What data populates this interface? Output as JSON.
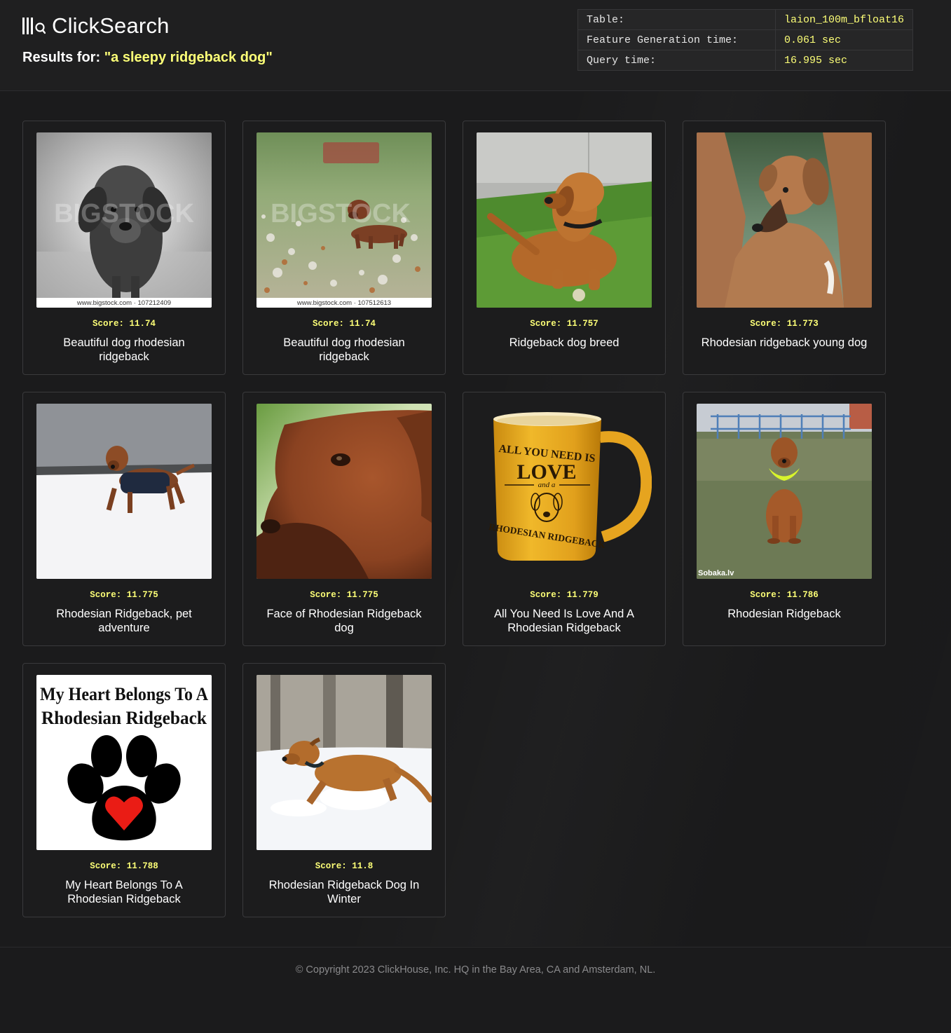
{
  "app": {
    "name": "ClickSearch",
    "logo_icon": "clickhouse-bars-search-icon"
  },
  "results": {
    "prefix": "Results for:",
    "query": "\"a sleepy ridgeback dog\""
  },
  "stats": {
    "rows": [
      {
        "label": "Table:",
        "value": "laion_100m_bfloat16"
      },
      {
        "label": "Feature Generation time:",
        "value": "0.061 sec"
      },
      {
        "label": "Query time:",
        "value": "16.995 sec"
      }
    ]
  },
  "items": [
    {
      "score_label": "Score: 11.74",
      "caption": "Beautiful dog rhodesian ridgeback",
      "image": "bw-puppy-photo",
      "watermark_text": "www.bigstock.com · 107212409",
      "watermark_logo": "BIGSTOCK"
    },
    {
      "score_label": "Score: 11.74",
      "caption": "Beautiful dog rhodesian ridgeback",
      "image": "puppy-in-field-photo",
      "watermark_text": "www.bigstock.com · 107512613",
      "watermark_logo": "BIGSTOCK"
    },
    {
      "score_label": "Score: 11.757",
      "caption": "Ridgeback dog breed",
      "image": "dog-lying-grass-photo"
    },
    {
      "score_label": "Score: 11.773",
      "caption": "Rhodesian ridgeback young dog",
      "image": "young-dog-closeup-photo"
    },
    {
      "score_label": "Score: 11.775",
      "caption": "Rhodesian Ridgeback, pet adventure",
      "image": "dog-in-snow-jacket-photo"
    },
    {
      "score_label": "Score: 11.775",
      "caption": "Face of Rhodesian Ridgeback dog",
      "image": "dog-face-profile-photo"
    },
    {
      "score_label": "Score: 11.779",
      "caption": "All You Need Is Love And A Rhodesian Ridgeback",
      "image": "yellow-mug-photo",
      "mug_text": {
        "line1": "ALL YOU NEED IS",
        "line2": "LOVE",
        "line3": "and a",
        "line4": "RHODESIAN RIDGEBACK"
      }
    },
    {
      "score_label": "Score: 11.786",
      "caption": "Rhodesian Ridgeback",
      "image": "dog-sitting-park-photo",
      "watermark_text": "Sobaka.lv"
    },
    {
      "score_label": "Score: 11.788",
      "caption": "My Heart Belongs To A Rhodesian Ridgeback",
      "image": "paw-heart-graphic",
      "graphic_text": {
        "line1": "My Heart Belongs To A",
        "line2": "Rhodesian Ridgeback"
      }
    },
    {
      "score_label": "Score: 11.8",
      "caption": "Rhodesian Ridgeback Dog In Winter",
      "image": "dog-running-snow-photo"
    }
  ],
  "footer": {
    "text": "© Copyright 2023 ClickHouse, Inc. HQ in the Bay Area, CA and Amsterdam, NL."
  },
  "colors": {
    "background": "#1b1b1c",
    "accent_yellow": "#fdff77",
    "card_border": "#3a3a3c",
    "footer_text": "#8a8a8c"
  }
}
